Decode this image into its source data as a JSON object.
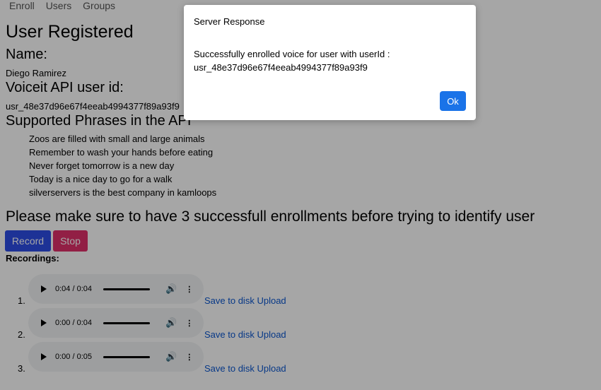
{
  "nav": {
    "items": [
      "Enroll",
      "Users",
      "Groups"
    ]
  },
  "page": {
    "title": "User Registered",
    "name_label": "Name:",
    "name_value": "Diego Ramirez",
    "api_label": "Voiceit API user id:",
    "api_value": "usr_48e37d96e67f4eeab4994377f89a93f9",
    "phrases_label": "Supported Phrases in the API",
    "phrases": [
      "Zoos are filled with small and large animals",
      "Remember to wash your hands before eating",
      "Never forget tomorrow is a new day",
      "Today is a nice day to go for a walk",
      "silverservers is the best company in kamloops"
    ],
    "note": "Please make sure to have 3 successfull enrollments before trying to identify user",
    "record_label": "Record",
    "stop_label": "Stop",
    "recordings_label": "Recordings:",
    "recordings": [
      {
        "num": "1.",
        "time": "0:04 / 0:04",
        "save": "Save to disk",
        "upload": "Upload"
      },
      {
        "num": "2.",
        "time": "0:00 / 0:04",
        "save": "Save to disk",
        "upload": "Upload"
      },
      {
        "num": "3.",
        "time": "0:00 / 0:05",
        "save": "Save to disk",
        "upload": "Upload"
      }
    ]
  },
  "modal": {
    "title": "Server Response",
    "message": "Successfully enrolled voice for user with userId : usr_48e37d96e67f4eeab4994377f89a93f9",
    "ok_label": "Ok"
  },
  "colors": {
    "record": "#2d4ee6",
    "stop": "#e0306a",
    "ok": "#1a73e8",
    "link": "#0b57d0"
  }
}
